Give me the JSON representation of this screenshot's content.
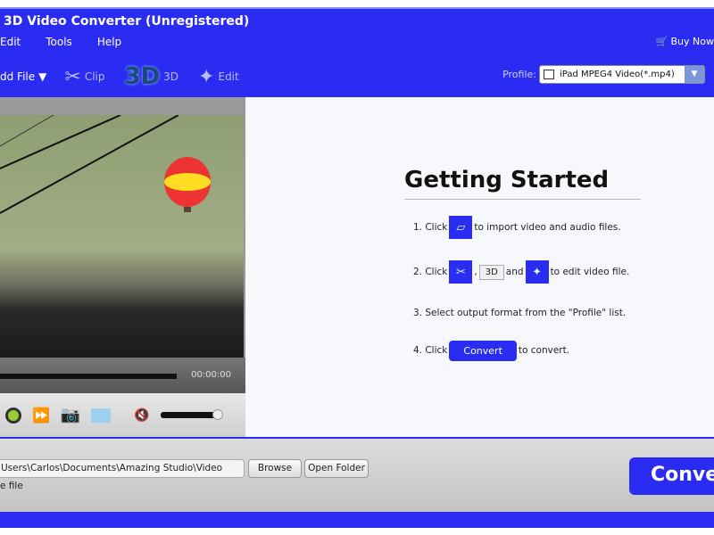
{
  "app": {
    "title": "3D Video Converter (Unregistered)"
  },
  "menu": [
    "Edit",
    "Tools",
    "Help"
  ],
  "buy_now": "Buy Now",
  "toolbar": {
    "add_file": "dd File",
    "clip": "Clip",
    "three_d": "3D",
    "edit": "Edit",
    "logo_3d": "3D"
  },
  "profile": {
    "label": "Profile:",
    "value": "iPad MPEG4 Video(*.mp4)"
  },
  "player": {
    "time": "00:00:00",
    "volume_percent": 100
  },
  "getting_started": {
    "title": "Getting Started",
    "step1_a": "1. Click",
    "step1_b": "to import video and audio files.",
    "step2_a": "2. Click",
    "step2_comma": ",",
    "step2_3d": "3D",
    "step2_and": "and",
    "step2_b": "to edit video file.",
    "step3": "3. Select output format from the \"Profile\" list.",
    "step4_a": "4. Click",
    "step4_btn": "Convert",
    "step4_b": "to convert."
  },
  "output": {
    "path": "Users\\Carlos\\Documents\\Amazing Studio\\Video",
    "browse": "Browse",
    "open_folder": "Open Folder",
    "save_label": "e file"
  },
  "convert": "Conve",
  "colors": {
    "brand": "#2b2cf2"
  }
}
